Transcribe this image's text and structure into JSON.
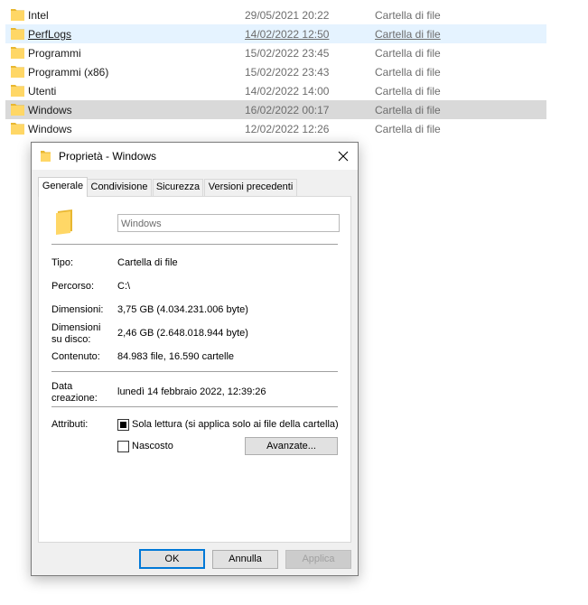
{
  "file_list": [
    {
      "name": "Intel",
      "date": "29/05/2021 20:22",
      "type": "Cartella di file"
    },
    {
      "name": "PerfLogs",
      "date": "14/02/2022 12:50",
      "type": "Cartella di file"
    },
    {
      "name": "Programmi",
      "date": "15/02/2022 23:45",
      "type": "Cartella di file"
    },
    {
      "name": "Programmi (x86)",
      "date": "15/02/2022 23:43",
      "type": "Cartella di file"
    },
    {
      "name": "Utenti",
      "date": "14/02/2022 14:00",
      "type": "Cartella di file"
    },
    {
      "name": "Windows",
      "date": "16/02/2022 00:17",
      "type": "Cartella di file"
    },
    {
      "name": "Windows",
      "date": "12/02/2022 12:26",
      "type": "Cartella di file"
    }
  ],
  "dialog": {
    "title": "Proprietà - Windows",
    "tabs": [
      "Generale",
      "Condivisione",
      "Sicurezza",
      "Versioni precedenti"
    ],
    "name_field": "Windows",
    "props": {
      "tipo_label": "Tipo:",
      "tipo": "Cartella di file",
      "percorso_label": "Percorso:",
      "percorso": "C:\\",
      "dimensioni_label": "Dimensioni:",
      "dimensioni": "3,75 GB (4.034.231.006 byte)",
      "dimensioni_disco_label_1": "Dimensioni",
      "dimensioni_disco_label_2": "su disco:",
      "dimensioni_disco": "2,46 GB (2.648.018.944 byte)",
      "contenuto_label": "Contenuto:",
      "contenuto": "84.983 file, 16.590 cartelle",
      "data_label_1": "Data",
      "data_label_2": "creazione:",
      "data": "lunedì 14 febbraio 2022, 12:39:26",
      "attributi_label": "Attributi:",
      "sola_lettura": "Sola lettura (si applica solo ai file della cartella)",
      "nascosto": "Nascosto",
      "avanzate": "Avanzate..."
    },
    "buttons": {
      "ok": "OK",
      "annulla": "Annulla",
      "applica": "Applica"
    }
  },
  "colors": {
    "folder": "#ffd766",
    "folder_dark": "#e8b731",
    "accent": "#0078d7",
    "selected_row": "#d9d9d9",
    "hover_row": "#e5f3ff"
  }
}
